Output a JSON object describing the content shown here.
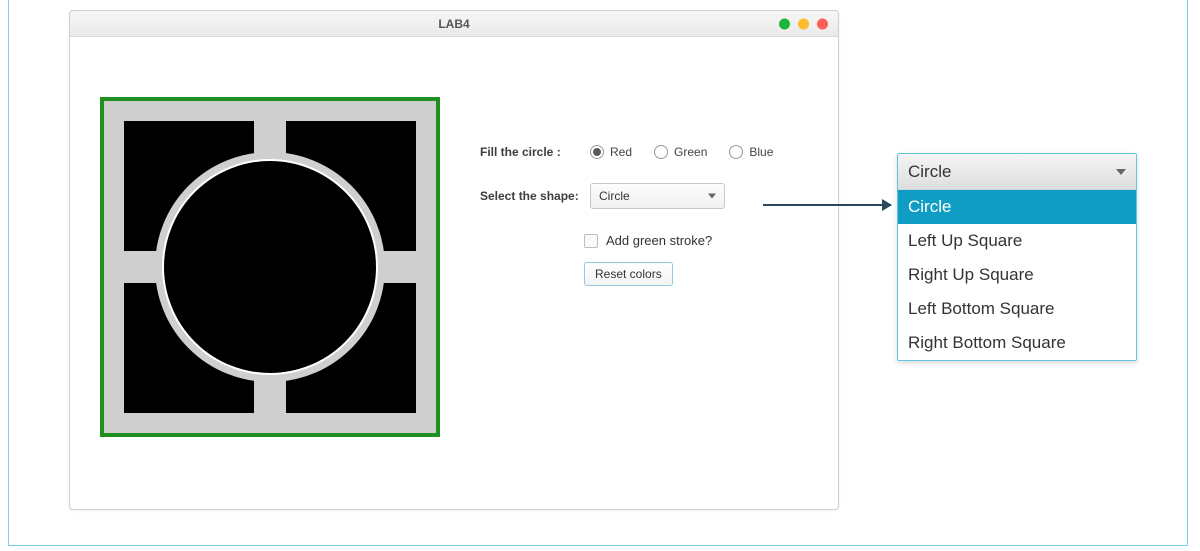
{
  "window": {
    "title": "LAB4"
  },
  "controls": {
    "fill_label": "Fill the circle :",
    "fill_options": {
      "red": "Red",
      "green": "Green",
      "blue": "Blue"
    },
    "fill_selected": "red",
    "shape_label": "Select the shape:",
    "shape_selected": "Circle",
    "checkbox_label": "Add green stroke?",
    "checkbox_checked": false,
    "reset_label": "Reset colors"
  },
  "dropdown": {
    "header": "Circle",
    "selected": "Circle",
    "items": [
      "Circle",
      "Left Up Square",
      "Right Up Square",
      "Left Bottom Square",
      "Right Bottom Square"
    ]
  },
  "colors": {
    "canvas_border": "#1f8f1f",
    "canvas_bg": "#cfcfcf",
    "shape_fill": "#000000",
    "circle_stroke": "#ffffff",
    "dropdown_highlight": "#0f9dc4"
  }
}
